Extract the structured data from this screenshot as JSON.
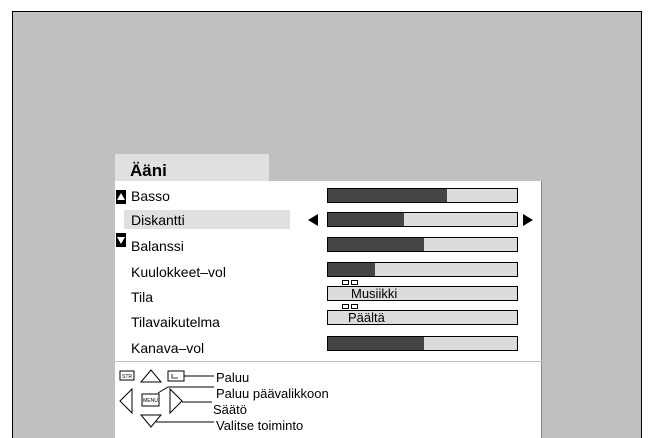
{
  "menu": {
    "title": "Ääni",
    "items": [
      {
        "label": "Basso",
        "type": "bar",
        "level": 0.63
      },
      {
        "label": "Diskantti",
        "type": "bar",
        "level": 0.4,
        "selected": true
      },
      {
        "label": "Balanssi",
        "type": "bar",
        "level": 0.51
      },
      {
        "label": "Kuulokkeet–vol",
        "type": "bar",
        "level": 0.25
      },
      {
        "label": "Tila",
        "type": "value",
        "value": "Musiikki"
      },
      {
        "label": "Tilavaikutelma",
        "type": "value",
        "value": "Päältä"
      },
      {
        "label": "Kanava–vol",
        "type": "bar",
        "level": 0.51
      }
    ]
  },
  "help": {
    "lines": [
      "Paluu",
      "Paluu päävalikkoon",
      "Säätö",
      "Valitse toiminto"
    ],
    "key_labels": {
      "str": "STR",
      "menu": "MENU"
    }
  },
  "colors": {
    "screen_bg": "#c0c0c0",
    "bar_fill": "#454545",
    "bar_track": "#dcdcdc",
    "selected_row": "#e0e0e0"
  }
}
